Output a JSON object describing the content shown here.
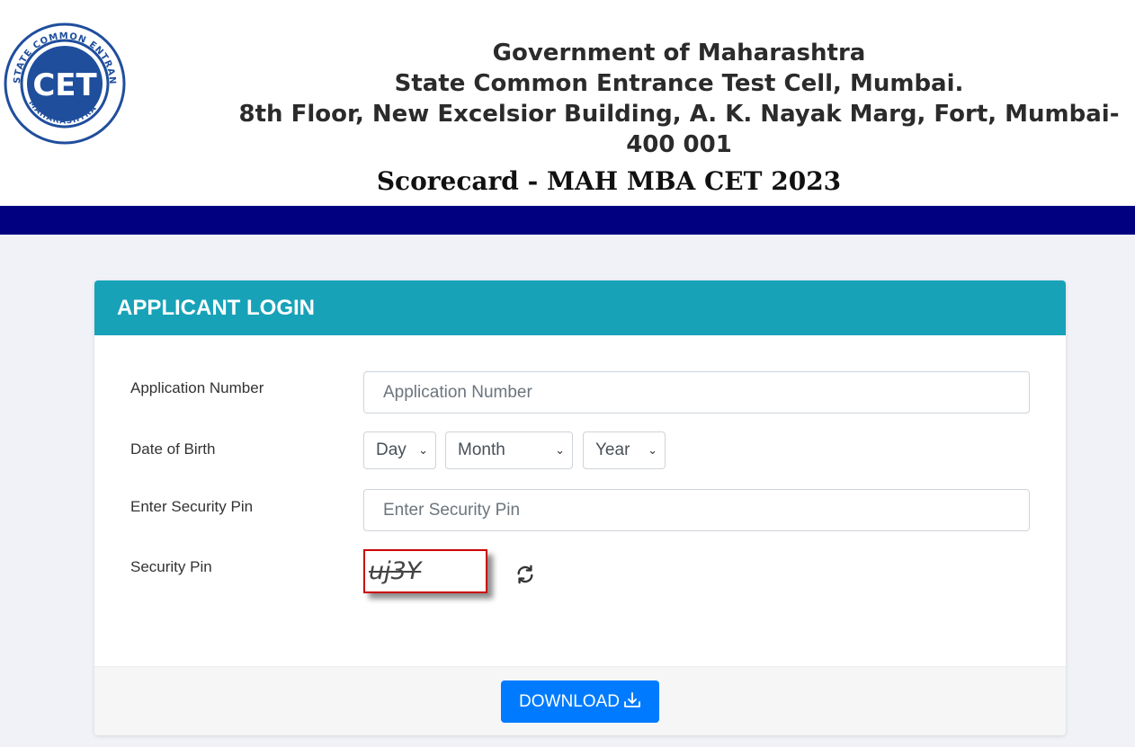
{
  "header": {
    "logo": {
      "ring_text_top": "STATE COMMON ENTRANCE TEST CELL",
      "ring_text_bottom": "MAHARASHTRA",
      "center_text": "CET",
      "color": "#1f4e9c"
    },
    "org_line1": "Government of Maharashtra",
    "org_line2": "State Common Entrance Test Cell, Mumbai.",
    "org_line3": "8th Floor, New Excelsior Building, A. K. Nayak Marg, Fort, Mumbai- 400 001",
    "page_title": "Scorecard - MAH MBA CET 2023",
    "band_color": "#000080"
  },
  "login": {
    "title": "APPLICANT LOGIN",
    "header_color": "#17a2b8",
    "application_number": {
      "label": "Application Number",
      "placeholder": "Application Number",
      "value": ""
    },
    "dob": {
      "label": "Date of Birth",
      "day": "Day",
      "month": "Month",
      "year": "Year"
    },
    "security_pin_input": {
      "label": "Enter Security Pin",
      "placeholder": "Enter Security Pin",
      "value": ""
    },
    "captcha": {
      "label": "Security Pin",
      "text": "uj3Y",
      "refresh_icon": "refresh-icon"
    },
    "download_button": {
      "label": "DOWNLOAD",
      "icon": "download-icon",
      "color": "#007bff"
    }
  }
}
